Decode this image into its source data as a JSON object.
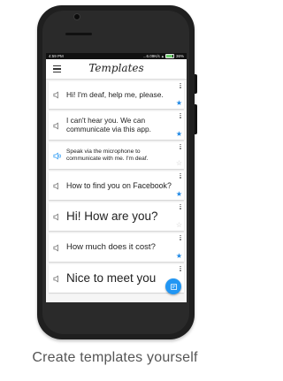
{
  "status_bar": {
    "time": "4:59 PM",
    "speed": "...6.09K/s",
    "battery": "36%"
  },
  "app_bar": {
    "menu_icon": "hamburger-icon",
    "title": "Templates"
  },
  "templates": [
    {
      "text": "Hi! I'm deaf, help me, please.",
      "starred": true,
      "speaker_active": false
    },
    {
      "text": "I can't hear you. We can communicate via this app.",
      "starred": true,
      "speaker_active": false
    },
    {
      "text": "Speak via the microphone to communicate with me. I'm deaf.",
      "starred": false,
      "speaker_active": true
    },
    {
      "text": "How to find you on Facebook?",
      "starred": true,
      "speaker_active": false
    },
    {
      "text": "Hi! How are you?",
      "starred": false,
      "speaker_active": false
    },
    {
      "text": "How much does it cost?",
      "starred": true,
      "speaker_active": false
    },
    {
      "text": "Nice to meet you",
      "starred": false,
      "speaker_active": false
    }
  ],
  "fab": {
    "icon": "edit-note-icon"
  },
  "caption": "Create templates yourself",
  "colors": {
    "accent": "#2196f3",
    "star_on": "#1e88e5",
    "star_off": "#c8c8c8",
    "speaker_active": "#2196f3"
  }
}
